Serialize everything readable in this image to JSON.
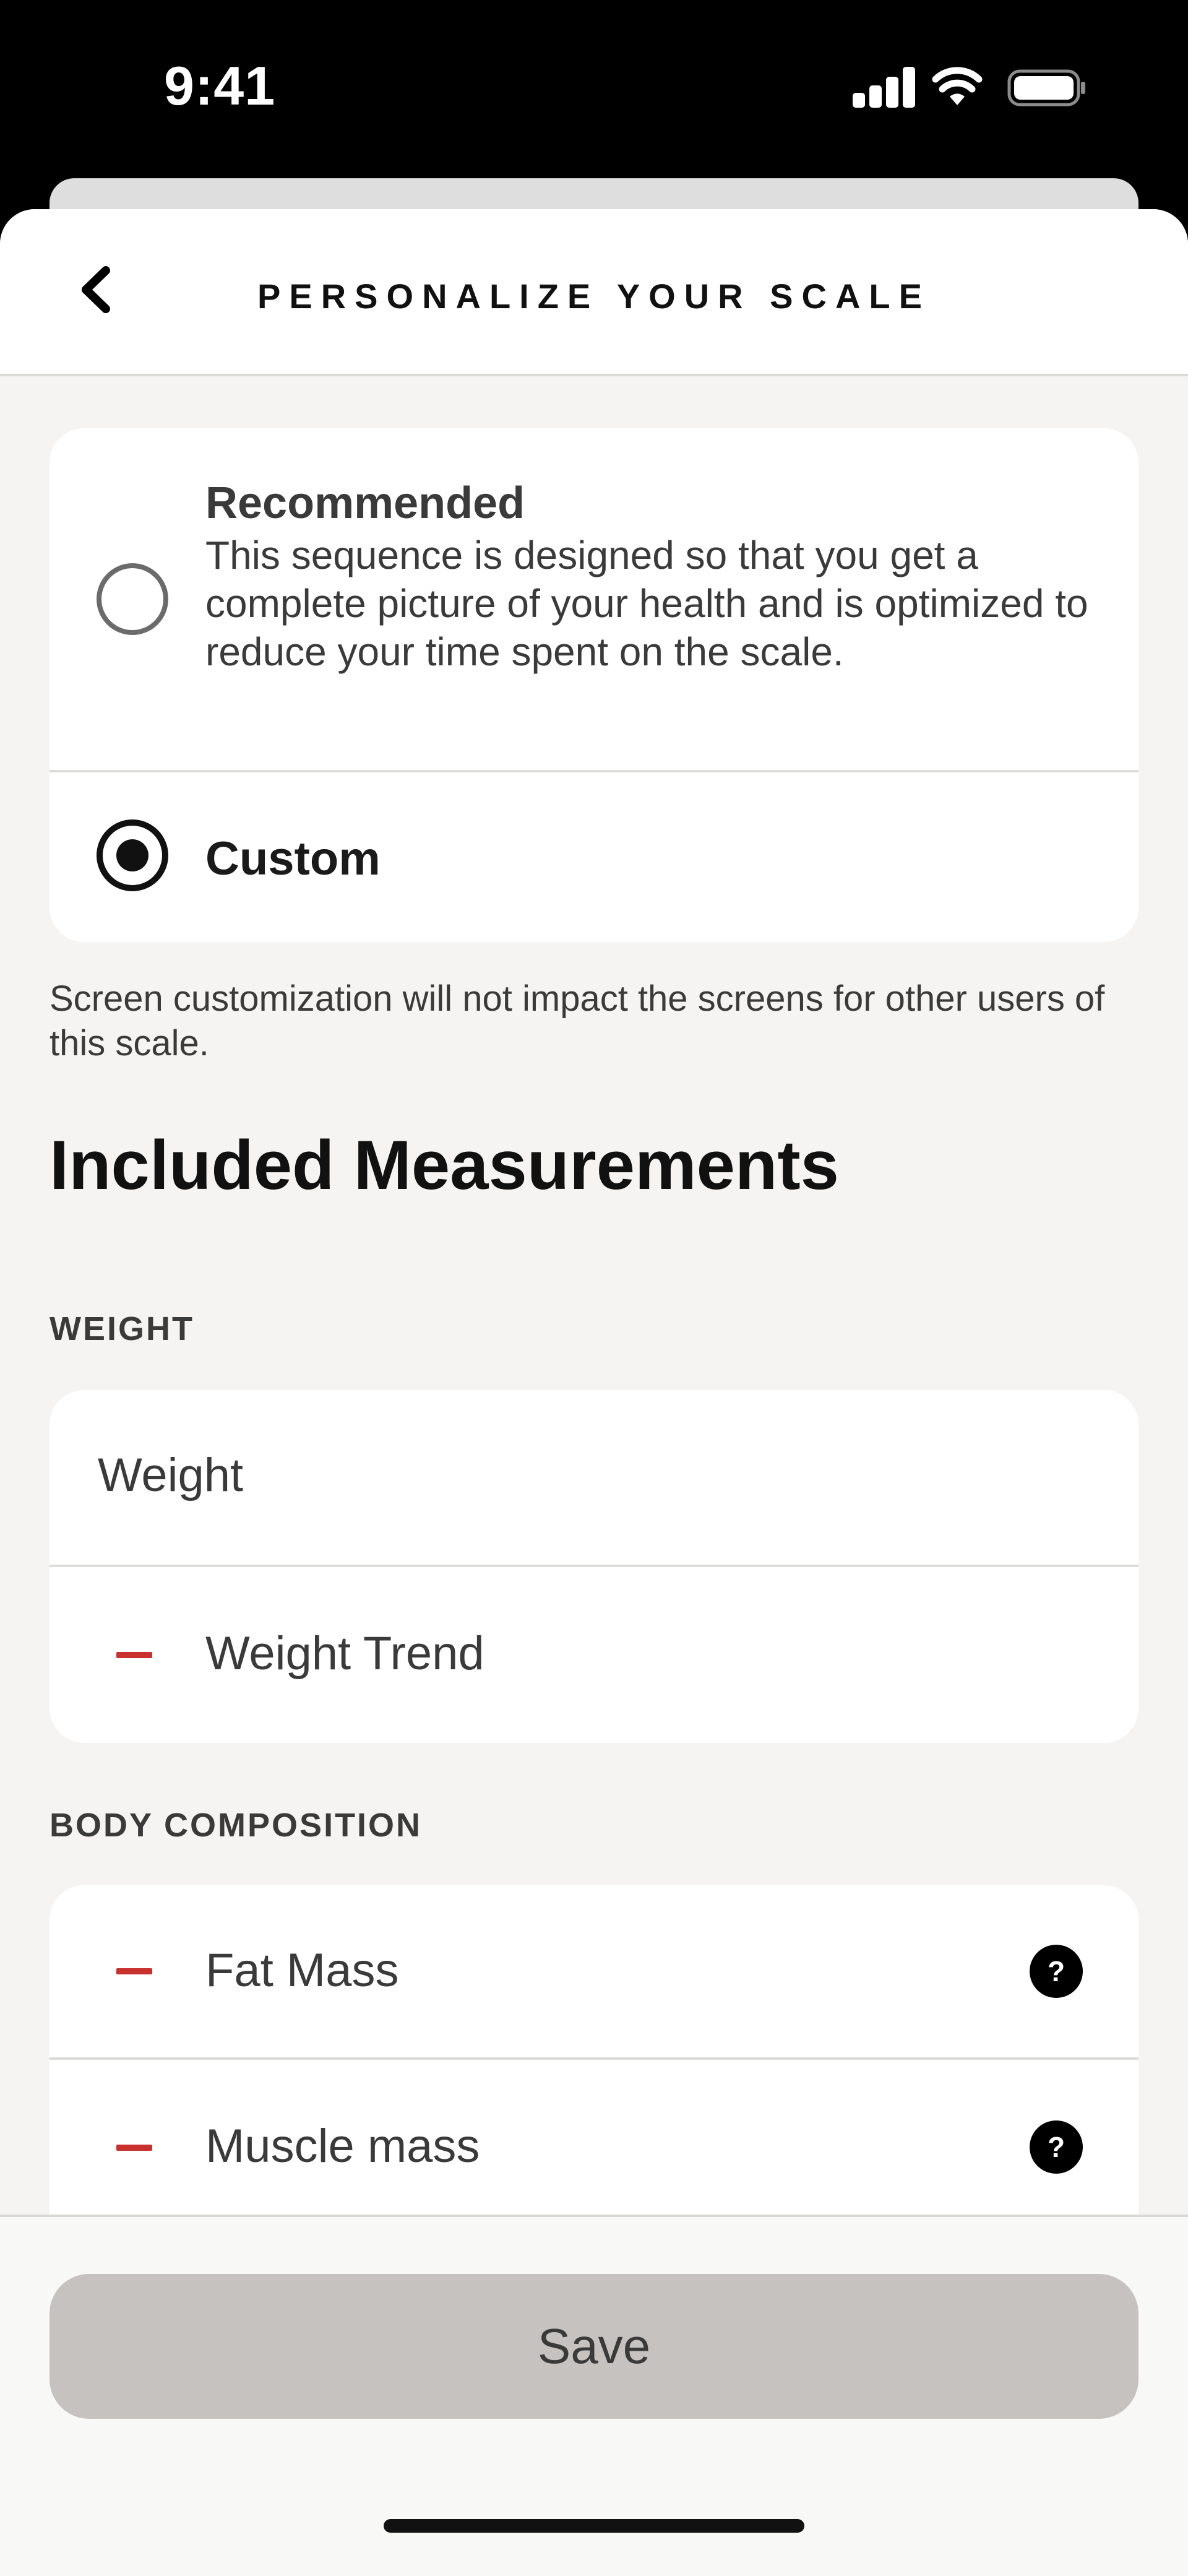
{
  "status_bar": {
    "time": "9:41",
    "icons": [
      "cellular-signal-icon",
      "wifi-icon",
      "battery-icon"
    ]
  },
  "header": {
    "back_icon": "chevron-left-icon",
    "title": "PERSONALIZE YOUR SCALE"
  },
  "mode_options": [
    {
      "title": "Recommended",
      "description": "This sequence is designed so that you get a complete picture of your health and is optimized to reduce your time spent on the scale.",
      "selected": false
    },
    {
      "title": "Custom",
      "selected": true
    }
  ],
  "note": "Screen customization will not impact the screens for other users of this scale.",
  "section_heading": "Included Measurements",
  "groups": [
    {
      "label": "WEIGHT",
      "items": [
        {
          "label": "Weight",
          "removable": false
        },
        {
          "label": "Weight Trend",
          "removable": true
        }
      ]
    },
    {
      "label": "BODY COMPOSITION",
      "items": [
        {
          "label": "Fat Mass",
          "removable": true,
          "help_icon": "question-mark-icon",
          "help_text": "?"
        },
        {
          "label": "Muscle mass",
          "removable": true,
          "help_icon": "question-mark-icon",
          "help_text": "?"
        }
      ]
    }
  ],
  "footer": {
    "save_label": "Save"
  },
  "colors": {
    "accent_remove": "#c8312e",
    "save_button_disabled": "#c5c2bf",
    "sheet_background": "#f5f4f2"
  }
}
